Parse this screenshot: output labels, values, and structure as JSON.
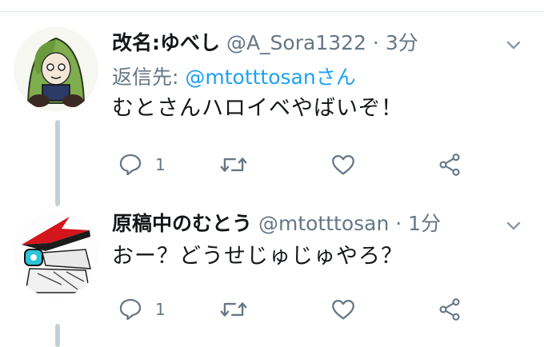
{
  "colors": {
    "text_primary": "#14171a",
    "text_secondary": "#657786",
    "link": "#1da1f2",
    "thread_line": "#c4cfd6",
    "icon": "#657786"
  },
  "tweets": [
    {
      "display_name": "改名:ゆべし",
      "handle": "@A_Sora1322",
      "separator": "·",
      "time": "3分",
      "reply_to_label": "返信先: ",
      "reply_to_handle": "@mtotttosan",
      "reply_to_suffix": "さん",
      "text": "むとさんハロイベやばいぞ！",
      "reply_icon": "reply-icon",
      "reply_count": "1",
      "retweet_icon": "retweet-icon",
      "like_icon": "heart-icon",
      "share_icon": "share-icon",
      "menu_icon": "chevron-down-icon"
    },
    {
      "display_name": "原稿中のむとう",
      "handle": "@mtotttosan",
      "separator": "·",
      "time": "1分",
      "text": "おー？どうせじゅじゅやろ？",
      "reply_icon": "reply-icon",
      "reply_count": "1",
      "retweet_icon": "retweet-icon",
      "like_icon": "heart-icon",
      "share_icon": "share-icon",
      "menu_icon": "chevron-down-icon"
    }
  ]
}
